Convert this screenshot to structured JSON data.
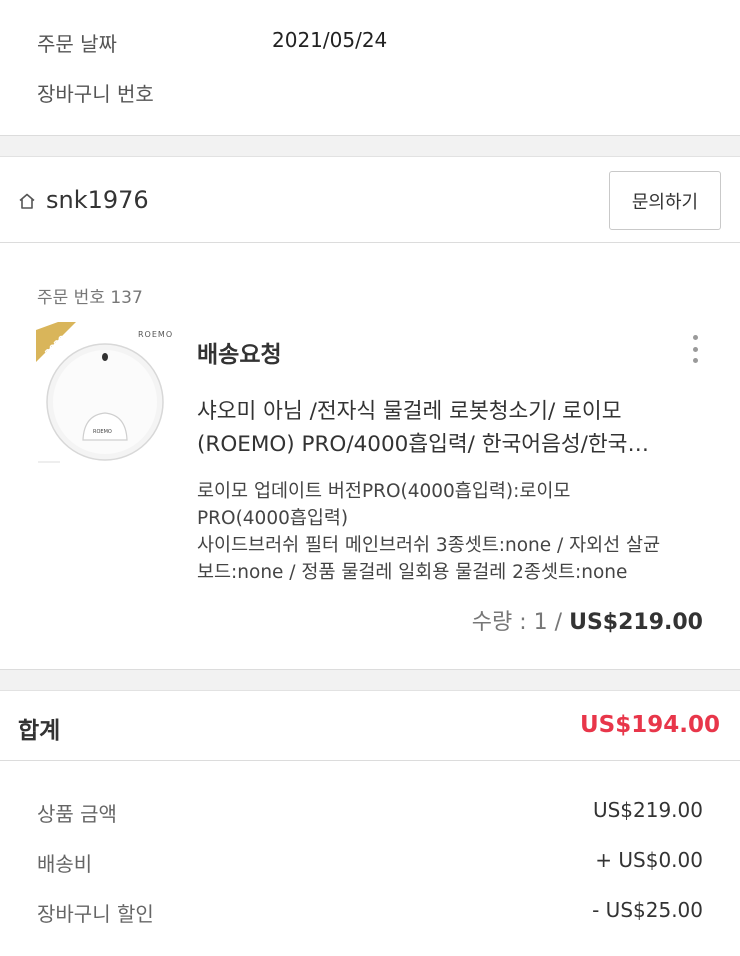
{
  "order_info": {
    "date_label": "주문 날짜",
    "date_value": "2021/05/24",
    "cart_number_label": "장바구니 번호"
  },
  "seller": {
    "name": "snk1976",
    "home_icon": "home-icon",
    "inquiry_label": "문의하기"
  },
  "order": {
    "number_label": "주문 번호 137",
    "status": "배송요청",
    "product_image_brand": "ROEMO",
    "product_image_device_brand": "ROEMO",
    "product_image_badge": "2020",
    "title_line1": "샤오미 아님 /전자식 물걸레 로봇청소기/ 로이모",
    "title_line2": "(ROEMO) PRO/4000흡입력/ 한국어음성/한국…",
    "options": [
      "로이모 업데이트 버전PRO(4000흡입력):로이모",
      "PRO(4000흡입력)",
      "사이드브러쉬 필터 메인브러쉬 3종셋트:none / 자외선 살균",
      "보드:none / 정품 물걸레 일회용 물걸레 2종셋트:none"
    ],
    "quantity_text": "수량 : 1 / ",
    "price": "US$219.00",
    "more_icon": "more-vertical-icon"
  },
  "totals": {
    "total_label": "합계",
    "total_value": "US$194.00",
    "rows": [
      {
        "label": "상품 금액",
        "value": "US$219.00"
      },
      {
        "label": "배송비",
        "value": "+ US$0.00"
      },
      {
        "label": "장바구니 할인",
        "value": "- US$25.00"
      }
    ]
  },
  "colors": {
    "accent_red": "#e8364a",
    "background": "#f2f2f2"
  }
}
